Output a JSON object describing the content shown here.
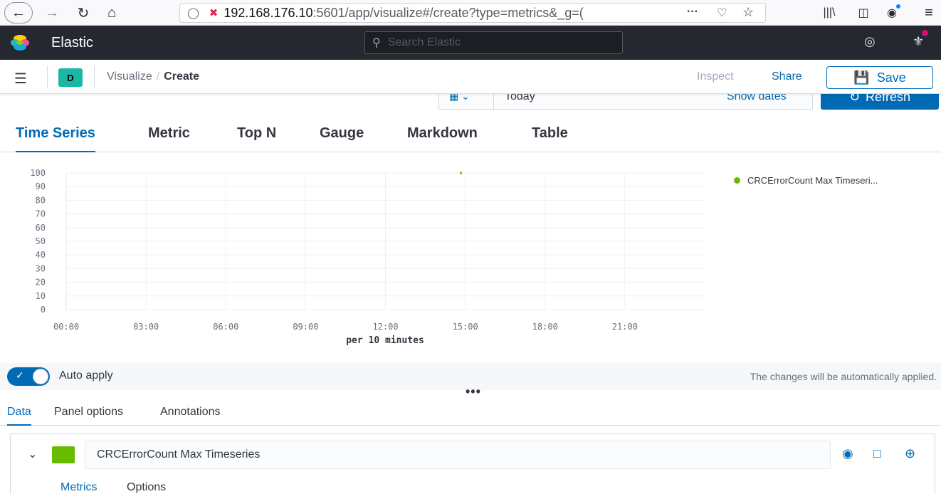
{
  "browser": {
    "url_host": "192.168.176.10",
    "url_rest": ":5601/app/visualize#/create?type=metrics&_g=(",
    "icons": [
      "back-icon",
      "forward-icon",
      "reload-icon",
      "home-icon",
      "shield-icon",
      "insecure-lock-icon",
      "more-icon",
      "pocket-icon",
      "star-icon",
      "library-icon",
      "sidebar-icon",
      "extension-icon",
      "menu-icon"
    ]
  },
  "header": {
    "title": "Elastic",
    "search_placeholder": "Search Elastic"
  },
  "breadcrumb": {
    "space_badge": "D",
    "parent": "Visualize",
    "separator": "/",
    "current": "Create",
    "inspect": "Inspect",
    "share": "Share",
    "save": "Save"
  },
  "datebar": {
    "date": "Today",
    "show_dates": "Show dates",
    "refresh": "Refresh"
  },
  "viz_tabs": [
    "Time Series",
    "Metric",
    "Top N",
    "Gauge",
    "Markdown",
    "Table"
  ],
  "chart_data": {
    "type": "line",
    "xlabel": "per 10 minutes",
    "x_ticks": [
      "00:00",
      "03:00",
      "06:00",
      "09:00",
      "12:00",
      "15:00",
      "18:00",
      "21:00"
    ],
    "y_ticks": [
      "0",
      "10",
      "20",
      "30",
      "40",
      "50",
      "60",
      "70",
      "80",
      "90",
      "100"
    ],
    "ylim": [
      0,
      100
    ],
    "grid": true,
    "series": [
      {
        "name": "CRCErrorCount Max Timeseri...",
        "color": "#68bc00",
        "points": [
          {
            "x": "14:50",
            "y": 100
          }
        ]
      }
    ]
  },
  "auto_apply": {
    "label": "Auto apply",
    "note": "The changes will be automatically applied.",
    "enabled": true
  },
  "resize_handle": "•••",
  "panel_tabs": [
    "Data",
    "Panel options",
    "Annotations"
  ],
  "series_panel": {
    "name": "CRCErrorCount Max Timeseries",
    "color": "#68bc00",
    "tabs": [
      "Metrics",
      "Options"
    ]
  }
}
